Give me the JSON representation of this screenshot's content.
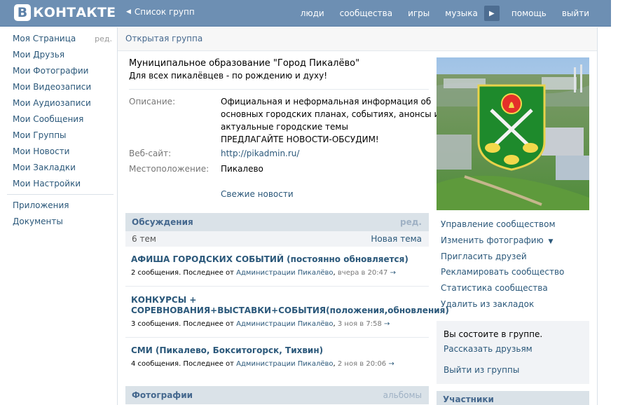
{
  "header": {
    "logo_letter": "В",
    "logo_text": "КОНТАКТЕ",
    "back_label": "Список групп",
    "nav": [
      "люди",
      "сообщества",
      "игры",
      "музыка",
      "помощь",
      "выйти"
    ]
  },
  "left_menu": {
    "edit_label": "ред.",
    "items": [
      "Моя Страница",
      "Мои Друзья",
      "Мои Фотографии",
      "Мои Видеозаписи",
      "Мои Аудиозаписи",
      "Мои Сообщения",
      "Мои Группы",
      "Мои Новости",
      "Мои Закладки",
      "Мои Настройки"
    ],
    "extra": [
      "Приложения",
      "Документы"
    ]
  },
  "group": {
    "type_label": "Открытая группа",
    "name": "Муниципальное образование \"Город Пикалёво\"",
    "slogan": "Для всех пикалёвцев - по рождению и духу!",
    "description_label": "Описание:",
    "description_lines": [
      "Официальная и неформальная информация об",
      "основных городских планах, событиях, анонсы и",
      "актуальные городские темы",
      "ПРЕДЛАГАЙТЕ НОВОСТИ-ОБСУДИМ!"
    ],
    "website_label": "Веб-сайт:",
    "website": "http://pikadmin.ru/",
    "location_label": "Местоположение:",
    "location": "Пикалево",
    "fresh_news": "Свежие новости"
  },
  "discussions": {
    "title": "Обсуждения",
    "edit": "ред.",
    "count": "6 тем",
    "new_topic": "Новая тема",
    "topics": [
      {
        "title": "АФИША ГОРОДСКИХ СОБЫТИЙ (постоянно обновляется)",
        "meta": "2 сообщения. Последнее от",
        "who": "Администрации Пикалёво",
        "when": "вчера в 20:47",
        "arrow": "→"
      },
      {
        "title": "КОНКУРСЫ + СОРЕВНОВАНИЯ+ВЫСТАВКИ+СОБЫТИЯ(положения,обновления)",
        "meta": "3 сообщения. Последнее от",
        "who": "Администрации Пикалёво",
        "when": "3 ноя в 7:58",
        "arrow": "→"
      },
      {
        "title": "СМИ (Пикалево, Бокситогорск, Тихвин)",
        "meta": "4 сообщения. Последнее от",
        "who": "Администрации Пикалёво",
        "when": "2 ноя в 20:06",
        "arrow": "→"
      }
    ]
  },
  "photos": {
    "title": "Фотографии",
    "albums": "альбомы"
  },
  "actions": {
    "manage": "Управление сообществом",
    "change_photo": "Изменить фотографию",
    "invite": "Пригласить друзей",
    "advertise": "Рекламировать сообщество",
    "stats": "Статистика сообщества",
    "remove_bookmark": "Удалить из закладок"
  },
  "membership": {
    "status": "Вы состоите в группе.",
    "tell_friends": "Рассказать друзьям",
    "leave": "Выйти из группы"
  },
  "members": {
    "title": "Участники"
  },
  "colors": {
    "header": "#6d8fb3",
    "link": "#2b587a",
    "bar": "#dae2e8"
  }
}
